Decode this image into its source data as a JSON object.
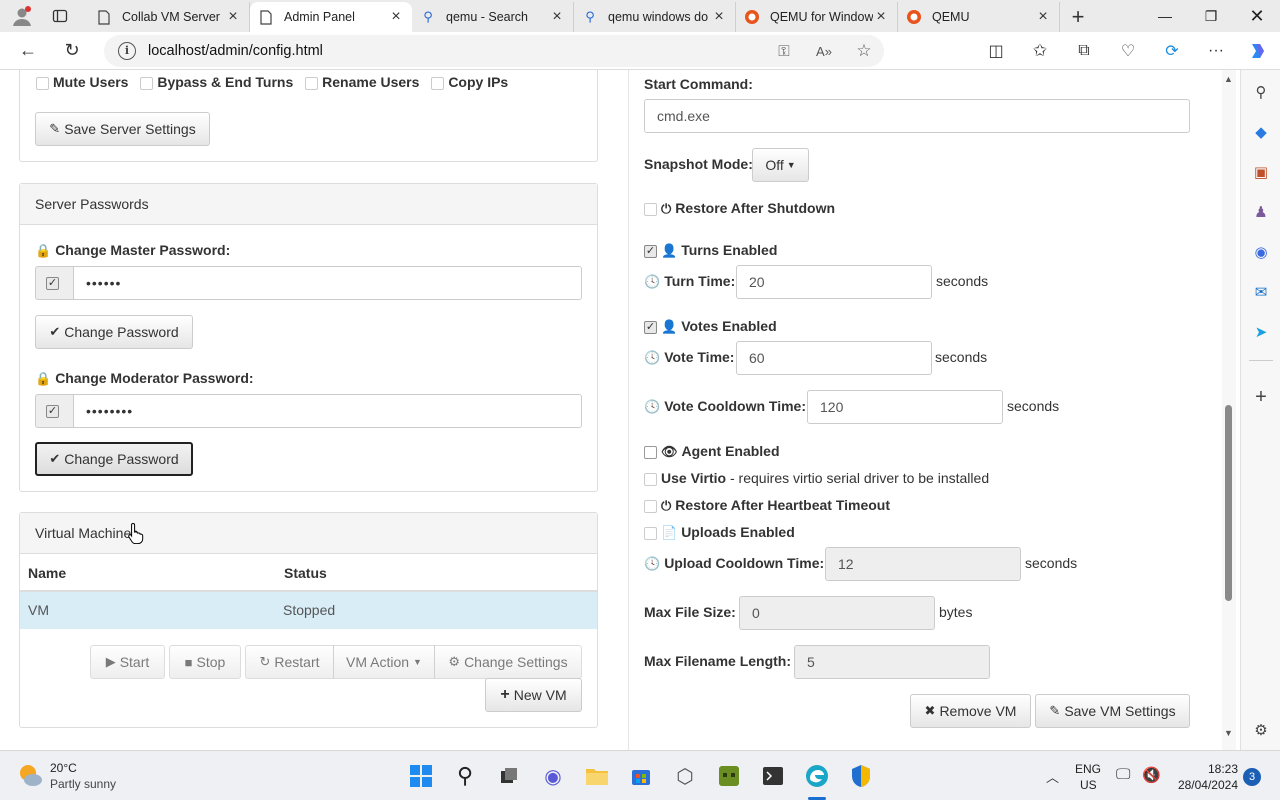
{
  "browser": {
    "tabs": [
      {
        "title": "Collab VM Server",
        "active": false
      },
      {
        "title": "Admin Panel",
        "active": true
      },
      {
        "title": "qemu - Search",
        "active": false
      },
      {
        "title": "qemu windows do",
        "active": false
      },
      {
        "title": "QEMU for Window",
        "active": false
      },
      {
        "title": "QEMU",
        "active": false
      }
    ],
    "url": "localhost/admin/config.html"
  },
  "server_settings": {
    "permissions": [
      "Mute Users",
      "Bypass & End Turns",
      "Rename Users",
      "Copy IPs"
    ],
    "save_label": "Save Server Settings"
  },
  "passwords": {
    "heading": "Server Passwords",
    "master_label": "Change Master Password:",
    "master_value": "••••••",
    "master_button": "Change Password",
    "moderator_label": "Change Moderator Password:",
    "moderator_value": "••••••••",
    "moderator_button": "Change Password"
  },
  "vms": {
    "heading": "Virtual Machines",
    "columns": [
      "Name",
      "Status"
    ],
    "rows": [
      {
        "name": "VM",
        "status": "Stopped"
      }
    ],
    "buttons": {
      "start": "Start",
      "stop": "Stop",
      "restart": "Restart",
      "vm_action": "VM Action",
      "change_settings": "Change Settings",
      "new_vm": "New VM"
    }
  },
  "vm_settings": {
    "start_command_label": "Start Command:",
    "start_command_value": "cmd.exe",
    "snapshot_label": "Snapshot Mode:",
    "snapshot_value": "Off",
    "restore_after_shutdown": "Restore After Shutdown",
    "turns_enabled": "Turns Enabled",
    "turn_time_label": "Turn Time:",
    "turn_time_value": "20",
    "votes_enabled": "Votes Enabled",
    "vote_time_label": "Vote Time:",
    "vote_time_value": "60",
    "vote_cooldown_label": "Vote Cooldown Time:",
    "vote_cooldown_value": "120",
    "seconds": "seconds",
    "agent_enabled": "Agent Enabled",
    "use_virtio": "Use Virtio",
    "use_virtio_note": " - requires virtio serial driver to be installed",
    "restore_after_heartbeat": "Restore After Heartbeat Timeout",
    "uploads_enabled": "Uploads Enabled",
    "upload_cooldown_label": "Upload Cooldown Time:",
    "upload_cooldown_value": "12",
    "max_file_size_label": "Max File Size:",
    "max_file_size_value": "0",
    "bytes": "bytes",
    "max_filename_label": "Max Filename Length:",
    "max_filename_value": "5",
    "remove_vm": "Remove VM",
    "save_vm": "Save VM Settings"
  },
  "taskbar": {
    "weather_temp": "20°C",
    "weather_desc": "Partly sunny",
    "lang_top": "ENG",
    "lang_bottom": "US",
    "time": "18:23",
    "date": "28/04/2024",
    "notifications": "3"
  }
}
